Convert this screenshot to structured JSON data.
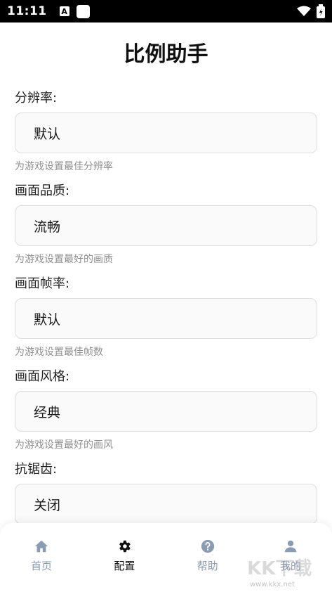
{
  "status_bar": {
    "time": "11:11",
    "a_icon_text": "A"
  },
  "title": "比例助手",
  "fields": [
    {
      "label": "分辨率:",
      "value": "默认",
      "hint": "为游戏设置最佳分辨率"
    },
    {
      "label": "画面品质:",
      "value": "流畅",
      "hint": "为游戏设置最好的画质"
    },
    {
      "label": "画面帧率:",
      "value": "默认",
      "hint": "为游戏设置最佳帧数"
    },
    {
      "label": "画面风格:",
      "value": "经典",
      "hint": "为游戏设置最好的画风"
    },
    {
      "label": "抗锯齿:",
      "value": "关闭"
    }
  ],
  "nav": [
    {
      "label": "首页",
      "icon": "home-icon"
    },
    {
      "label": "配置",
      "icon": "gear-icon",
      "active": true
    },
    {
      "label": "帮助",
      "icon": "help-icon"
    },
    {
      "label": "我的",
      "icon": "user-icon"
    }
  ],
  "watermark": {
    "text": "KK下载",
    "url": "www.kkx.net"
  },
  "colors": {
    "nav_inactive": "#8a9bb4",
    "nav_active": "#111111",
    "hint": "#8f8f8f",
    "box_border": "#dedede"
  }
}
